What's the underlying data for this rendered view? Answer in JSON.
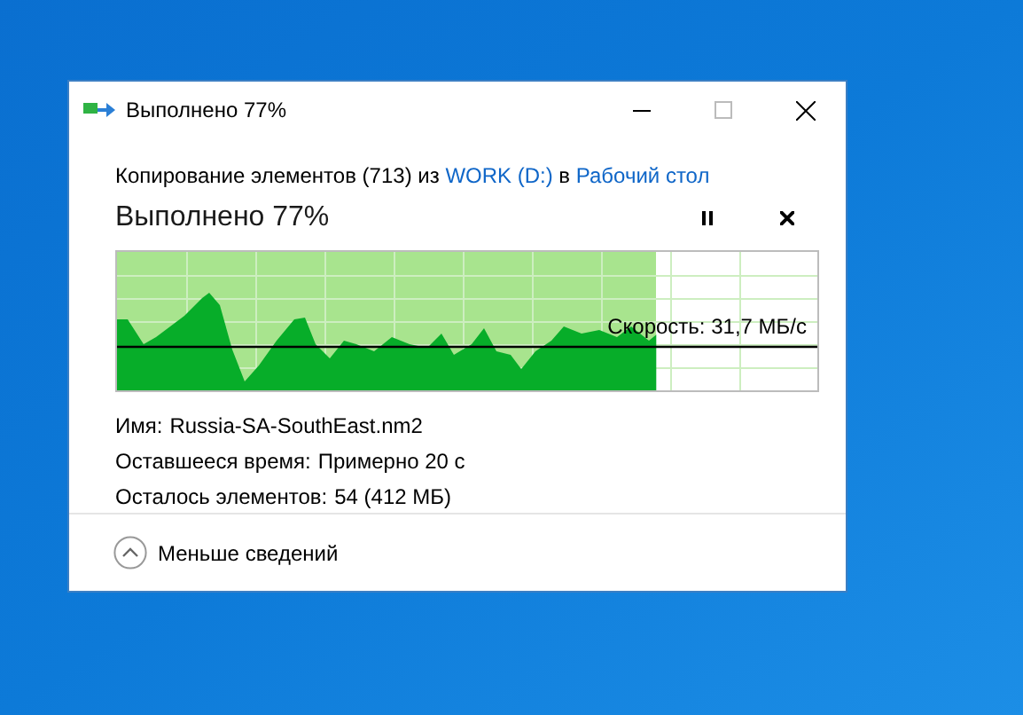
{
  "window": {
    "title": "Выполнено 77%"
  },
  "copy_line": [
    {
      "kind": "text",
      "text": "Копирование элементов (713) из "
    },
    {
      "kind": "link",
      "text": "WORK (D:)"
    },
    {
      "kind": "text",
      "text": " в "
    },
    {
      "kind": "link",
      "text": "Рабочий стол"
    }
  ],
  "status": "Выполнено 77%",
  "progress": {
    "level": 0.77,
    "speed": "Скорость: 31,7 МБ/с"
  },
  "details": [
    {
      "label": "Имя:",
      "value": "Russia-SA-SouthEast.nm2"
    },
    {
      "label": "Оставшееся время:",
      "value": "Примерно 20 с"
    },
    {
      "label": "Осталось элементов:",
      "value": "54 (412 МБ)"
    }
  ],
  "toggle": {
    "label": "Меньше сведений",
    "expanded": true
  }
}
